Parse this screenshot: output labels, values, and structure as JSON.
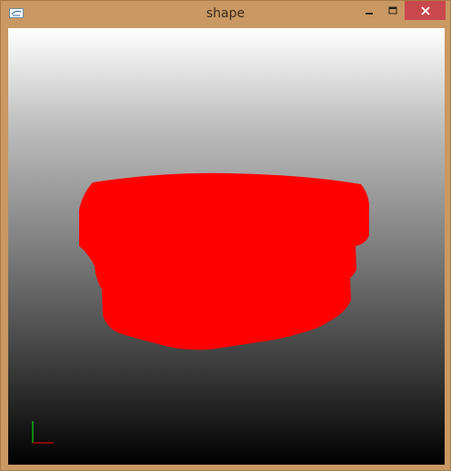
{
  "window": {
    "title": "shape"
  },
  "titlebar_icons": {
    "app": "app-icon",
    "minimize": "minimize-icon",
    "maximize": "maximize-icon",
    "close": "close-icon"
  },
  "scene": {
    "shape_color": "#ff0000",
    "axis_x_color": "#ff0000",
    "axis_y_color": "#00ff00"
  }
}
